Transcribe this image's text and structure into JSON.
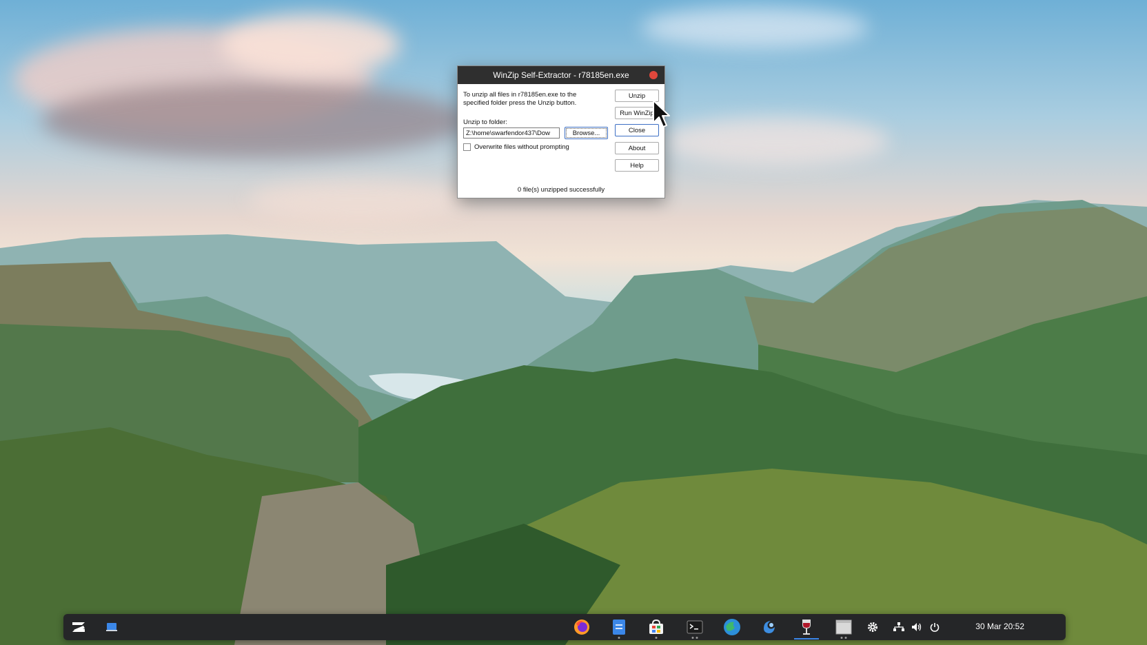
{
  "dialog": {
    "title": "WinZip Self-Extractor - r78185en.exe",
    "instructions": "To unzip all files in r78185en.exe to the specified folder press the Unzip button.",
    "folder_label": "Unzip to folder:",
    "folder_value": "Z:\\home\\swarfendor437\\Dow",
    "overwrite_label": "Overwrite files without prompting",
    "overwrite_checked": false,
    "buttons": {
      "browse": "Browse...",
      "unzip": "Unzip",
      "run_winzip": "Run WinZip",
      "close": "Close",
      "about": "About",
      "help": "Help"
    },
    "status": "0 file(s) unzipped successfully"
  },
  "taskbar": {
    "launcher_icon": "zorin-logo-icon",
    "show_desktop_icon": "show-desktop-icon",
    "apps": [
      {
        "icon": "firefox-icon"
      },
      {
        "icon": "files-icon"
      },
      {
        "icon": "software-store-icon"
      },
      {
        "icon": "terminal-icon"
      },
      {
        "icon": "web-browser-icon"
      },
      {
        "icon": "app-blue-swirl-icon"
      },
      {
        "icon": "wine-icon"
      },
      {
        "icon": "window-icon"
      }
    ],
    "tray": {
      "settings_icon": "settings-icon",
      "network_icon": "network-icon",
      "volume_icon": "volume-icon",
      "power_icon": "power-icon"
    },
    "clock": "30 Mar  20:52"
  }
}
